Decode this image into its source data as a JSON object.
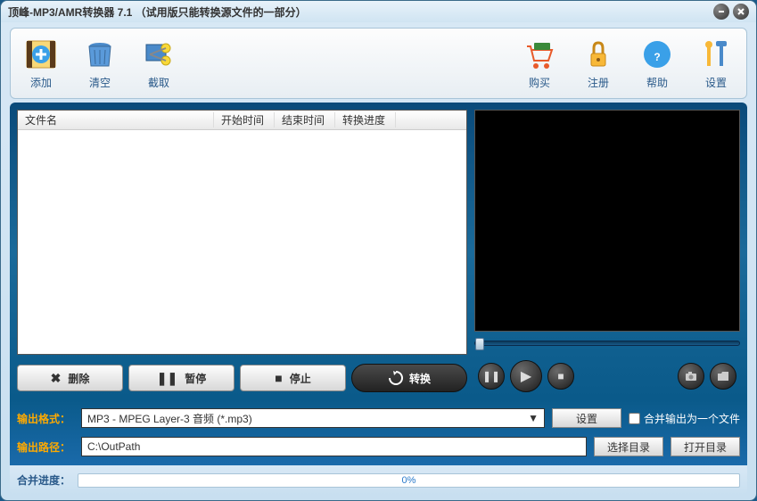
{
  "title": "顶峰-MP3/AMR转换器 7.1 （试用版只能转换源文件的一部分）",
  "toolbar": {
    "add": "添加",
    "clear": "清空",
    "cut": "截取",
    "buy": "购买",
    "register": "注册",
    "help": "帮助",
    "settings": "设置"
  },
  "columns": {
    "filename": "文件名",
    "start": "开始时间",
    "end": "结束时间",
    "progress": "转换进度"
  },
  "actions": {
    "delete": "删除",
    "pause": "暂停",
    "stop": "停止",
    "convert": "转换"
  },
  "output": {
    "format_label": "输出格式：",
    "format_value": "MP3 - MPEG Layer-3 音频 (*.mp3)",
    "settings_btn": "设置",
    "merge_check": "合并输出为一个文件",
    "path_label": "输出路径：",
    "path_value": "C:\\OutPath",
    "select_dir": "选择目录",
    "open_dir": "打开目录"
  },
  "progress": {
    "label": "合并进度：",
    "text": "0%"
  }
}
